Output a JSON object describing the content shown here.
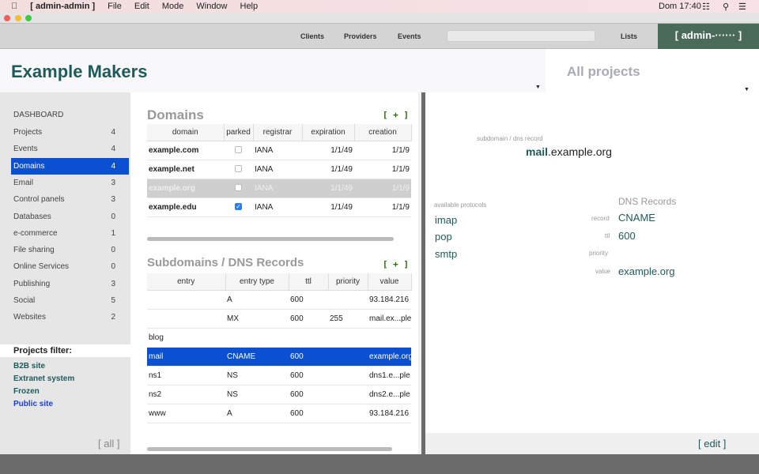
{
  "menubar": {
    "app": "[ admin-admin ]",
    "items": [
      "File",
      "Edit",
      "Mode",
      "Window",
      "Help"
    ],
    "clock": "Dom 17:40"
  },
  "toolbar": {
    "nav": [
      "Clients",
      "Providers",
      "Events"
    ],
    "search_value": "",
    "lists": "Lists",
    "user": "[ admin-······ ]"
  },
  "header": {
    "title": "Example Makers",
    "project_selector": "All projects"
  },
  "sidebar": {
    "dashboard": "DASHBOARD",
    "items": [
      {
        "label": "Projects",
        "count": "4"
      },
      {
        "label": "Events",
        "count": "4"
      },
      {
        "label": "Domains",
        "count": "4"
      },
      {
        "label": "Email",
        "count": "3"
      },
      {
        "label": "Control panels",
        "count": "3"
      },
      {
        "label": "Databases",
        "count": "0"
      },
      {
        "label": "e-commerce",
        "count": "1"
      },
      {
        "label": "File sharing",
        "count": "0"
      },
      {
        "label": "Online Services",
        "count": "0"
      },
      {
        "label": "Publishing",
        "count": "3"
      },
      {
        "label": "Social",
        "count": "5"
      },
      {
        "label": "Websites",
        "count": "2"
      }
    ],
    "selected": "Domains",
    "filter_title": "Projects filter:",
    "filters": [
      "B2B site",
      "Extranet system",
      "Frozen",
      "Public site"
    ],
    "all": "[ all ]"
  },
  "domains": {
    "title": "Domains",
    "add": "[ + ]",
    "columns": [
      "domain",
      "parked",
      "registrar",
      "expiration",
      "creation"
    ],
    "rows": [
      {
        "domain": "example.com",
        "parked": false,
        "registrar": "IANA",
        "expiration": "1/1/49",
        "creation": "1/1/9"
      },
      {
        "domain": "example.net",
        "parked": false,
        "registrar": "IANA",
        "expiration": "1/1/49",
        "creation": "1/1/9"
      },
      {
        "domain": "example.org",
        "parked": false,
        "registrar": "IANA",
        "expiration": "1/1/49",
        "creation": "1/1/9"
      },
      {
        "domain": "example.edu",
        "parked": true,
        "registrar": "IANA",
        "expiration": "1/1/49",
        "creation": "1/1/9"
      }
    ]
  },
  "subdomains": {
    "title": "Subdomains / DNS Records",
    "add": "[ + ]",
    "columns": [
      "entry",
      "entry type",
      "ttl",
      "priority",
      "value"
    ],
    "rows": [
      {
        "entry": "",
        "type": "A",
        "ttl": "600",
        "priority": "",
        "value": "93.184.216"
      },
      {
        "entry": "",
        "type": "MX",
        "ttl": "600",
        "priority": "255",
        "value": "mail.ex...ple"
      },
      {
        "entry": "blog",
        "type": "",
        "ttl": "",
        "priority": "",
        "value": ""
      },
      {
        "entry": "mail",
        "type": "CNAME",
        "ttl": "600",
        "priority": "",
        "value": "example.org"
      },
      {
        "entry": "ns1",
        "type": "NS",
        "ttl": "600",
        "priority": "",
        "value": "dns1.e...ple"
      },
      {
        "entry": "ns2",
        "type": "NS",
        "ttl": "600",
        "priority": "",
        "value": "dns2.e...ple"
      },
      {
        "entry": "www",
        "type": "A",
        "ttl": "600",
        "priority": "",
        "value": "93.184.216"
      }
    ]
  },
  "detail": {
    "label": "subdomain / dns record",
    "sub": "mail",
    "domain": ".example.org",
    "protocols_label": "available protocols",
    "protocols": [
      "imap",
      "pop",
      "smtp"
    ],
    "dns_title": "DNS Records",
    "record_label": "record",
    "record": "CNAME",
    "ttl_label": "ttl",
    "ttl": "600",
    "priority_label": "priority",
    "priority": "",
    "value_label": "value",
    "value": "example.org",
    "edit": "[ edit ]"
  },
  "colors": {
    "accent": "#1f5a5a",
    "selection": "#0a50d0",
    "user_bg": "#4a6b5a",
    "add": "#2b6a10"
  }
}
